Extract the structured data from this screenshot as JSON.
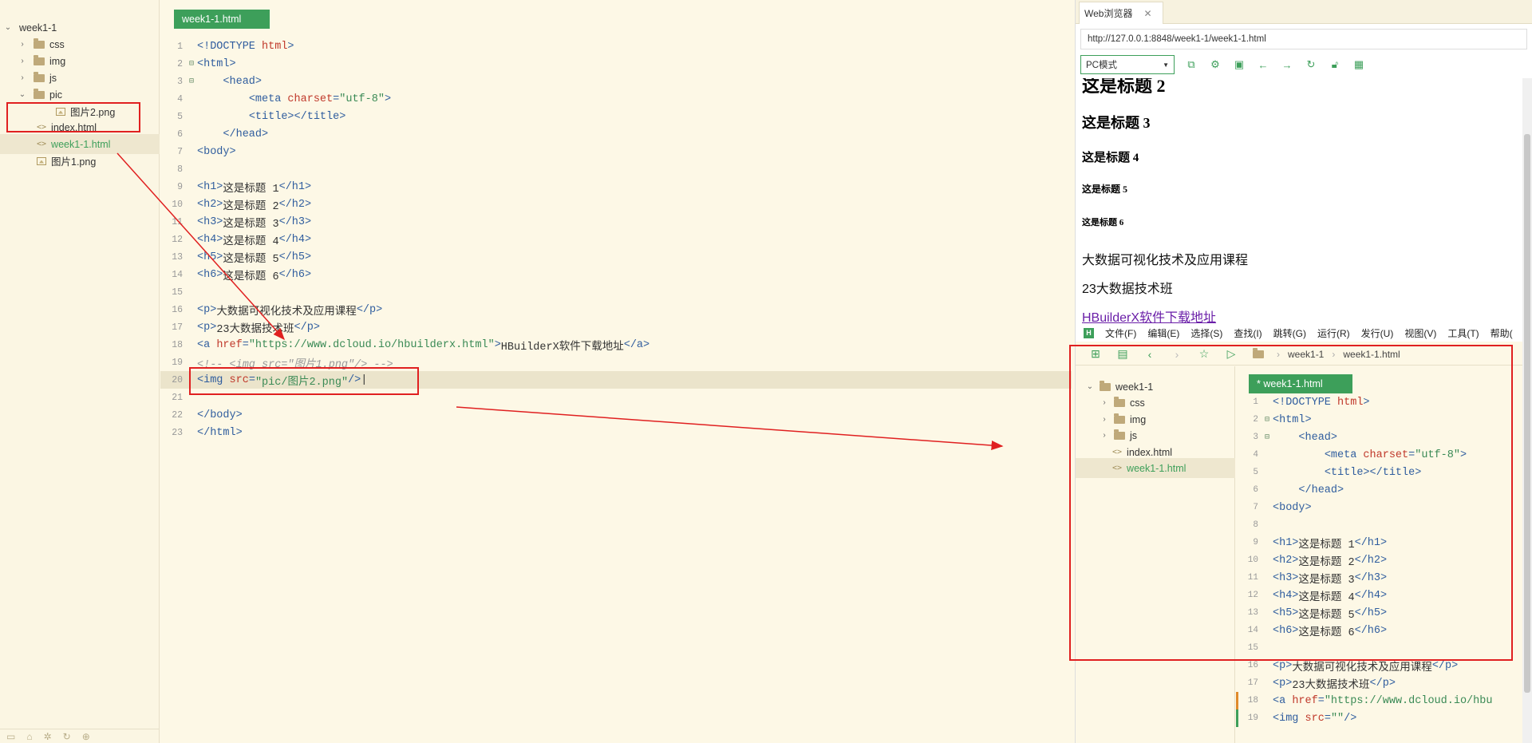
{
  "sidebar": {
    "project": "week1-1",
    "items": [
      {
        "label": "css",
        "kind": "folder"
      },
      {
        "label": "img",
        "kind": "folder"
      },
      {
        "label": "js",
        "kind": "folder"
      },
      {
        "label": "pic",
        "kind": "folder",
        "open": true
      },
      {
        "label": "图片2.png",
        "kind": "image"
      },
      {
        "label": "index.html",
        "kind": "code"
      },
      {
        "label": "week1-1.html",
        "kind": "code",
        "selected": true
      },
      {
        "label": "图片1.png",
        "kind": "image"
      }
    ]
  },
  "editor": {
    "tab": "week1-1.html",
    "current_line": 20
  },
  "browser": {
    "tab_label": "Web浏览器",
    "url": "http://127.0.0.1:8848/week1-1/week1-1.html",
    "mode": "PC模式",
    "page": {
      "h2": "这是标题 2",
      "h3": "这是标题 3",
      "h4": "这是标题 4",
      "h5": "这是标题 5",
      "h6": "这是标题 6",
      "p1": "大数据可视化技术及应用课程",
      "p2": "23大数据技术班",
      "link": "HBuilderX软件下载地址"
    },
    "screenshot": {
      "menu": [
        "文件(F)",
        "编辑(E)",
        "选择(S)",
        "查找(I)",
        "跳转(G)",
        "运行(R)",
        "发行(U)",
        "视图(V)",
        "工具(T)",
        "帮助("
      ],
      "breadcrumb": [
        "week1-1",
        "week1-1.html"
      ],
      "tab": "* week1-1.html",
      "tree": [
        "week1-1",
        "css",
        "img",
        "js",
        "index.html",
        "week1-1.html"
      ]
    }
  },
  "colors": {
    "accent": "#3d9f5a",
    "annotation": "#e02020",
    "editor_bg": "#fdf8e6"
  }
}
